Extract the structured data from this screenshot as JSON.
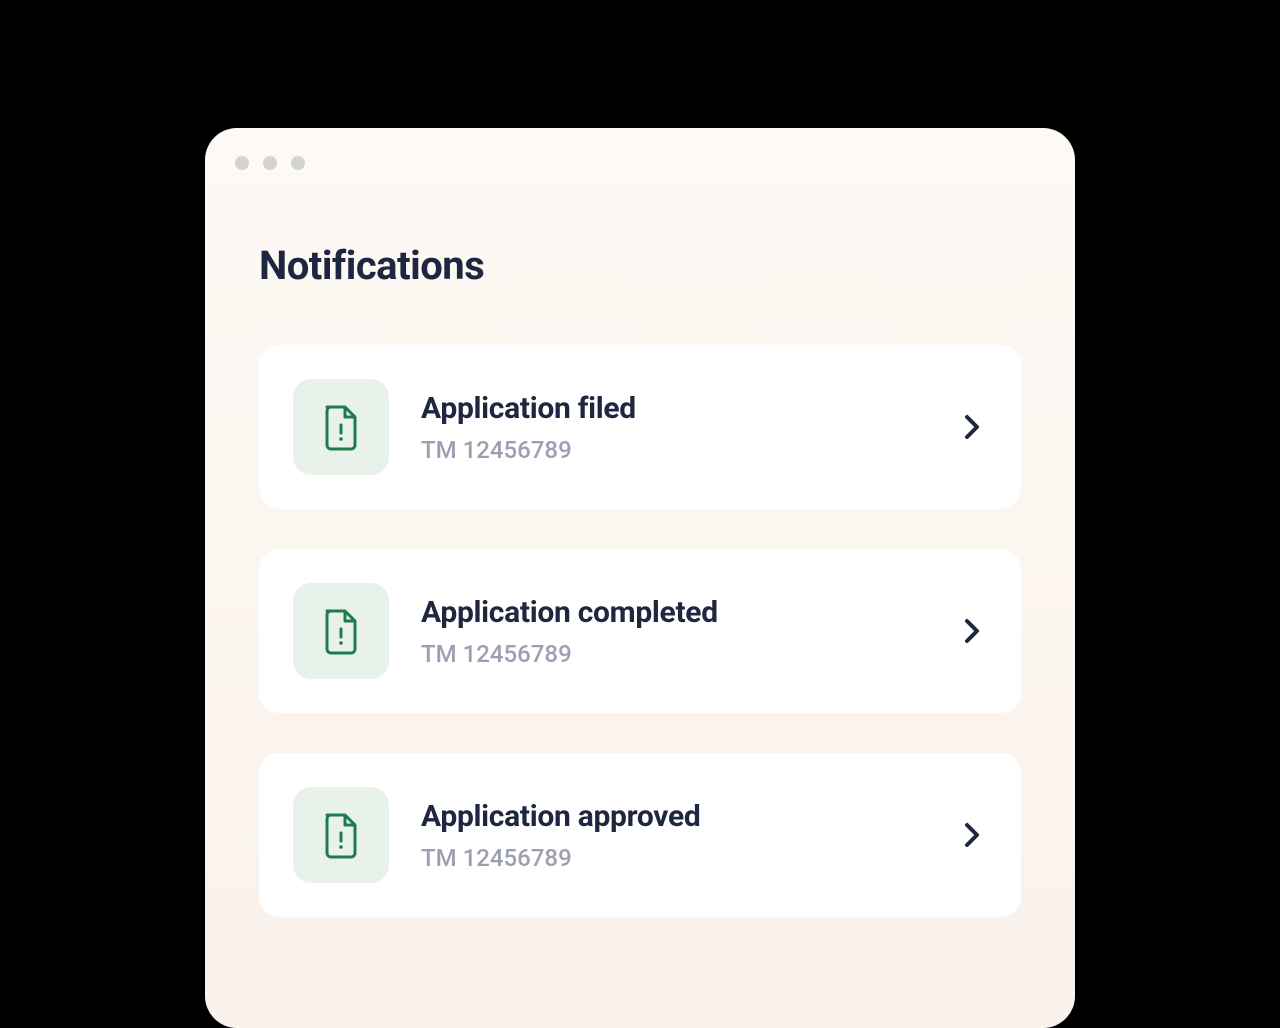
{
  "header": {
    "title": "Notifications"
  },
  "notifications": [
    {
      "title": "Application filed",
      "subtitle": "TM 12456789",
      "icon": "document-alert-icon"
    },
    {
      "title": "Application completed",
      "subtitle": "TM 12456789",
      "icon": "document-alert-icon"
    },
    {
      "title": "Application approved",
      "subtitle": "TM 12456789",
      "icon": "document-alert-icon"
    }
  ],
  "colors": {
    "accent_green": "#1f7a4c",
    "icon_bg": "#e8f1ea",
    "text_primary": "#1f2640",
    "text_secondary": "#9ca0b2",
    "window_bg_top": "#fdf9f4",
    "window_bg_bottom": "#faf2ec"
  }
}
